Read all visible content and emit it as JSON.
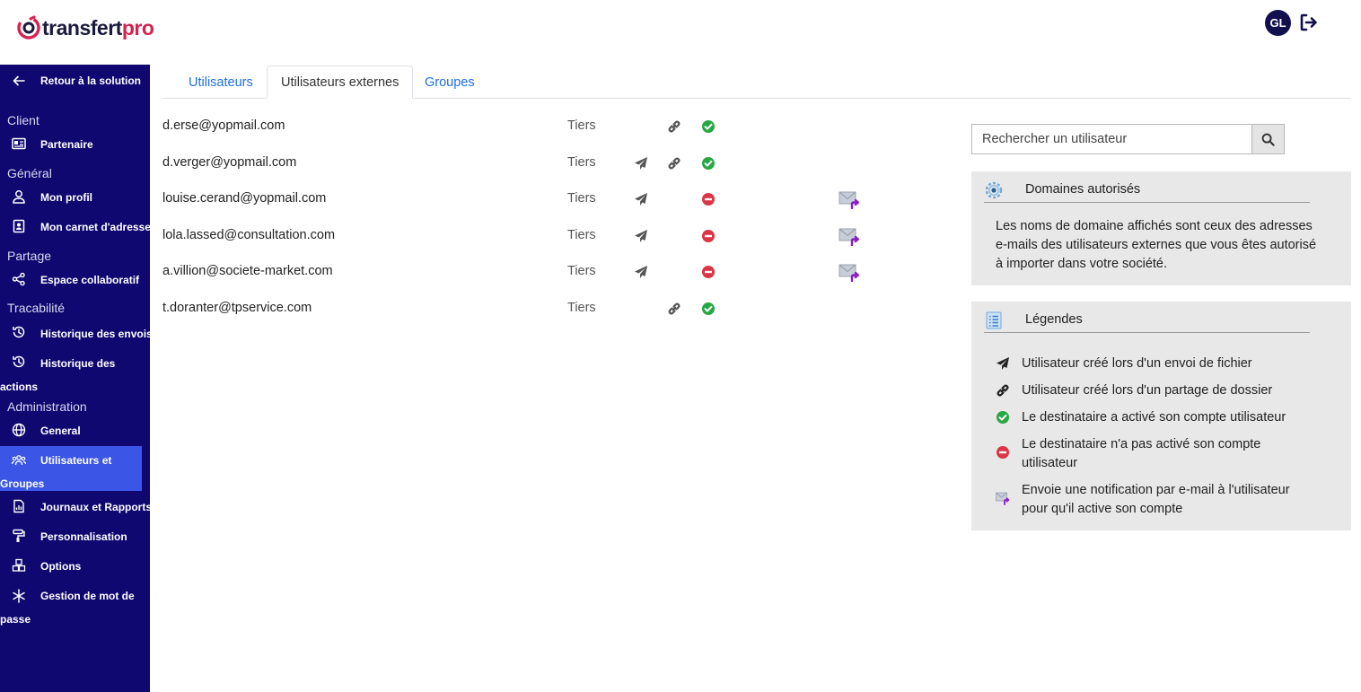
{
  "header": {
    "logo_main": "transfert",
    "logo_accent": "pro",
    "avatar_initials": "GL"
  },
  "sidebar": {
    "back_label": "Retour à la solution",
    "sections": {
      "client": "Client",
      "general": "Général",
      "partage": "Partage",
      "tracabilite": "Tracabilité",
      "administration": "Administration"
    },
    "items": {
      "partenaire": "Partenaire",
      "mon_profil": "Mon profil",
      "carnet": "Mon carnet d'adresse",
      "espace": "Espace collaboratif",
      "hist_envois": "Historique des envois",
      "hist_actions_1": "Historique des",
      "hist_actions_2": "actions",
      "general": "General",
      "utilisateurs_1": "Utilisateurs et",
      "utilisateurs_2": "Groupes",
      "journaux": "Journaux et Rapports",
      "perso": "Personnalisation",
      "options": "Options",
      "mdp_1": "Gestion de mot de",
      "mdp_2": "passe"
    }
  },
  "tabs": [
    {
      "label": "Utilisateurs"
    },
    {
      "label": "Utilisateurs externes"
    },
    {
      "label": "Groupes"
    }
  ],
  "users": [
    {
      "email": "d.erse@yopmail.com",
      "type": "Tiers",
      "send": false,
      "link": true,
      "activated": true,
      "notify": false
    },
    {
      "email": "d.verger@yopmail.com",
      "type": "Tiers",
      "send": true,
      "link": true,
      "activated": true,
      "notify": false
    },
    {
      "email": "louise.cerand@yopmail.com",
      "type": "Tiers",
      "send": true,
      "link": false,
      "activated": false,
      "notify": true
    },
    {
      "email": "lola.lassed@consultation.com",
      "type": "Tiers",
      "send": true,
      "link": false,
      "activated": false,
      "notify": true
    },
    {
      "email": "a.villion@societe-market.com",
      "type": "Tiers",
      "send": true,
      "link": false,
      "activated": false,
      "notify": true
    },
    {
      "email": "t.doranter@tpservice.com",
      "type": "Tiers",
      "send": false,
      "link": true,
      "activated": true,
      "notify": false
    }
  ],
  "search": {
    "placeholder": "Rechercher un utilisateur"
  },
  "domains_panel": {
    "title": "Domaines autorisés",
    "text": "Les noms de domaine affichés sont ceux des adresses e-mails des utilisateurs externes que vous êtes autorisé à importer dans votre société."
  },
  "legend_panel": {
    "title": "Légendes",
    "items": {
      "send": "Utilisateur créé lors d'un envoi de fichier",
      "link": "Utilisateur créé lors d'un partage de dossier",
      "active": "Le destinataire a activé son compte utilisateur",
      "inactive": "Le destinataire n'a pas activé son compte utilisateur",
      "notify": "Envoie une notification par e-mail à l'utilisateur pour qu'il active son compte"
    }
  },
  "colors": {
    "sidebar_bg": "#0e0870",
    "sidebar_active": "#3b55e6",
    "accent_pink": "#d6224f",
    "link_blue": "#1f6fe0",
    "success_green": "#28a745",
    "danger_red": "#dc3545",
    "notify_purple": "#8a1ec9"
  }
}
